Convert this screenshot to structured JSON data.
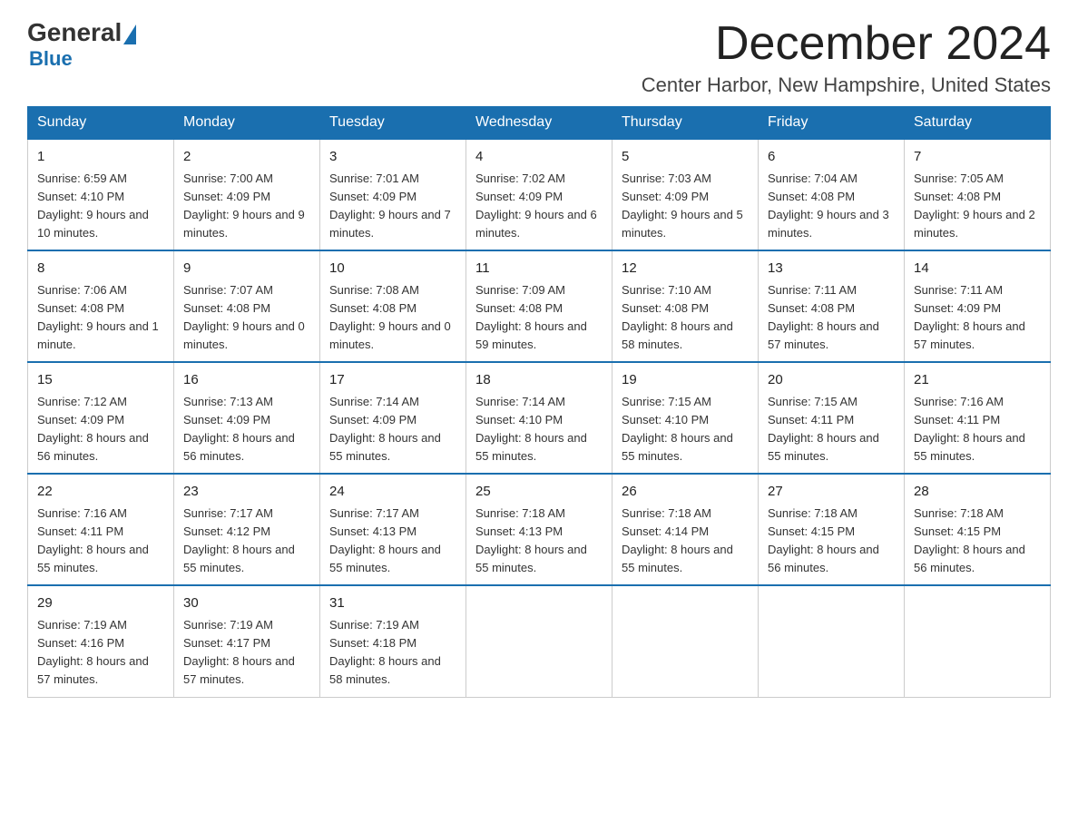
{
  "logo": {
    "general": "General",
    "blue": "Blue",
    "triangle": "▶"
  },
  "title": "December 2024",
  "location": "Center Harbor, New Hampshire, United States",
  "days_of_week": [
    "Sunday",
    "Monday",
    "Tuesday",
    "Wednesday",
    "Thursday",
    "Friday",
    "Saturday"
  ],
  "weeks": [
    [
      {
        "day": "1",
        "sunrise": "6:59 AM",
        "sunset": "4:10 PM",
        "daylight": "9 hours and 10 minutes."
      },
      {
        "day": "2",
        "sunrise": "7:00 AM",
        "sunset": "4:09 PM",
        "daylight": "9 hours and 9 minutes."
      },
      {
        "day": "3",
        "sunrise": "7:01 AM",
        "sunset": "4:09 PM",
        "daylight": "9 hours and 7 minutes."
      },
      {
        "day": "4",
        "sunrise": "7:02 AM",
        "sunset": "4:09 PM",
        "daylight": "9 hours and 6 minutes."
      },
      {
        "day": "5",
        "sunrise": "7:03 AM",
        "sunset": "4:09 PM",
        "daylight": "9 hours and 5 minutes."
      },
      {
        "day": "6",
        "sunrise": "7:04 AM",
        "sunset": "4:08 PM",
        "daylight": "9 hours and 3 minutes."
      },
      {
        "day": "7",
        "sunrise": "7:05 AM",
        "sunset": "4:08 PM",
        "daylight": "9 hours and 2 minutes."
      }
    ],
    [
      {
        "day": "8",
        "sunrise": "7:06 AM",
        "sunset": "4:08 PM",
        "daylight": "9 hours and 1 minute."
      },
      {
        "day": "9",
        "sunrise": "7:07 AM",
        "sunset": "4:08 PM",
        "daylight": "9 hours and 0 minutes."
      },
      {
        "day": "10",
        "sunrise": "7:08 AM",
        "sunset": "4:08 PM",
        "daylight": "9 hours and 0 minutes."
      },
      {
        "day": "11",
        "sunrise": "7:09 AM",
        "sunset": "4:08 PM",
        "daylight": "8 hours and 59 minutes."
      },
      {
        "day": "12",
        "sunrise": "7:10 AM",
        "sunset": "4:08 PM",
        "daylight": "8 hours and 58 minutes."
      },
      {
        "day": "13",
        "sunrise": "7:11 AM",
        "sunset": "4:08 PM",
        "daylight": "8 hours and 57 minutes."
      },
      {
        "day": "14",
        "sunrise": "7:11 AM",
        "sunset": "4:09 PM",
        "daylight": "8 hours and 57 minutes."
      }
    ],
    [
      {
        "day": "15",
        "sunrise": "7:12 AM",
        "sunset": "4:09 PM",
        "daylight": "8 hours and 56 minutes."
      },
      {
        "day": "16",
        "sunrise": "7:13 AM",
        "sunset": "4:09 PM",
        "daylight": "8 hours and 56 minutes."
      },
      {
        "day": "17",
        "sunrise": "7:14 AM",
        "sunset": "4:09 PM",
        "daylight": "8 hours and 55 minutes."
      },
      {
        "day": "18",
        "sunrise": "7:14 AM",
        "sunset": "4:10 PM",
        "daylight": "8 hours and 55 minutes."
      },
      {
        "day": "19",
        "sunrise": "7:15 AM",
        "sunset": "4:10 PM",
        "daylight": "8 hours and 55 minutes."
      },
      {
        "day": "20",
        "sunrise": "7:15 AM",
        "sunset": "4:11 PM",
        "daylight": "8 hours and 55 minutes."
      },
      {
        "day": "21",
        "sunrise": "7:16 AM",
        "sunset": "4:11 PM",
        "daylight": "8 hours and 55 minutes."
      }
    ],
    [
      {
        "day": "22",
        "sunrise": "7:16 AM",
        "sunset": "4:11 PM",
        "daylight": "8 hours and 55 minutes."
      },
      {
        "day": "23",
        "sunrise": "7:17 AM",
        "sunset": "4:12 PM",
        "daylight": "8 hours and 55 minutes."
      },
      {
        "day": "24",
        "sunrise": "7:17 AM",
        "sunset": "4:13 PM",
        "daylight": "8 hours and 55 minutes."
      },
      {
        "day": "25",
        "sunrise": "7:18 AM",
        "sunset": "4:13 PM",
        "daylight": "8 hours and 55 minutes."
      },
      {
        "day": "26",
        "sunrise": "7:18 AM",
        "sunset": "4:14 PM",
        "daylight": "8 hours and 55 minutes."
      },
      {
        "day": "27",
        "sunrise": "7:18 AM",
        "sunset": "4:15 PM",
        "daylight": "8 hours and 56 minutes."
      },
      {
        "day": "28",
        "sunrise": "7:18 AM",
        "sunset": "4:15 PM",
        "daylight": "8 hours and 56 minutes."
      }
    ],
    [
      {
        "day": "29",
        "sunrise": "7:19 AM",
        "sunset": "4:16 PM",
        "daylight": "8 hours and 57 minutes."
      },
      {
        "day": "30",
        "sunrise": "7:19 AM",
        "sunset": "4:17 PM",
        "daylight": "8 hours and 57 minutes."
      },
      {
        "day": "31",
        "sunrise": "7:19 AM",
        "sunset": "4:18 PM",
        "daylight": "8 hours and 58 minutes."
      },
      null,
      null,
      null,
      null
    ]
  ]
}
